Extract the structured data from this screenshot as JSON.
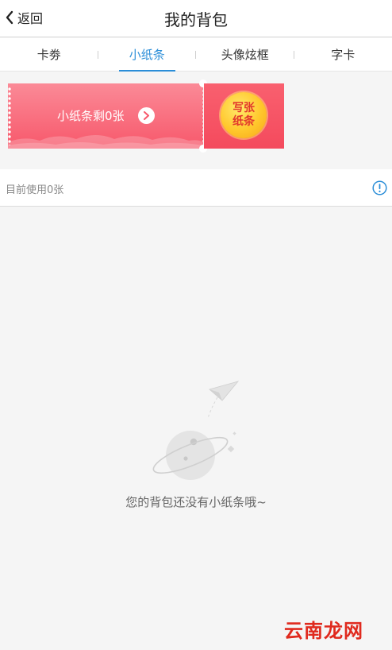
{
  "header": {
    "back_label": "返回",
    "title": "我的背包"
  },
  "tabs": [
    {
      "label": "卡劵",
      "active": false
    },
    {
      "label": "小纸条",
      "active": true
    },
    {
      "label": "头像炫框",
      "active": false
    },
    {
      "label": "字卡",
      "active": false
    }
  ],
  "coupon": {
    "remaining_text": "小纸条剩0张",
    "write_line1": "写张",
    "write_line2": "纸条"
  },
  "status": {
    "text": "目前使用0张"
  },
  "empty_state": {
    "message": "您的背包还没有小纸条哦~"
  },
  "watermark": "云南龙网",
  "colors": {
    "accent": "#2b8ed8",
    "coupon_red": "#f7586b",
    "button_yellow": "#ffc72c"
  }
}
